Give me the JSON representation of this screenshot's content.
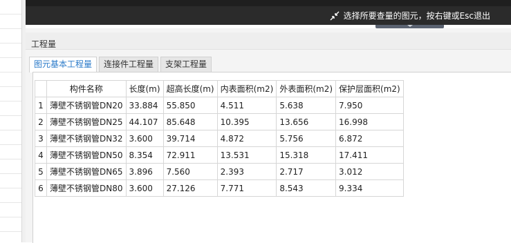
{
  "topbar": {
    "hint_text": "选择所要查量的图元，按右键或Esc退出"
  },
  "panel": {
    "title": "工程量",
    "tabs": [
      {
        "label": "图元基本工程量",
        "active": true
      },
      {
        "label": "连接件工程量",
        "active": false
      },
      {
        "label": "支架工程量",
        "active": false
      }
    ]
  },
  "table": {
    "columns": [
      "构件名称",
      "长度(m)",
      "超高长度(m)",
      "内表面积(m2)",
      "外表面积(m2)",
      "保护层面积(m2)"
    ],
    "rows": [
      {
        "index": "1",
        "name": "薄壁不锈钢管DN20",
        "length": "33.884",
        "over_length": "55.850",
        "inner_area": "4.511",
        "outer_area": "5.638",
        "protect_area": "7.950"
      },
      {
        "index": "2",
        "name": "薄壁不锈钢管DN25",
        "length": "44.107",
        "over_length": "85.648",
        "inner_area": "10.395",
        "outer_area": "13.656",
        "protect_area": "16.998"
      },
      {
        "index": "3",
        "name": "薄壁不锈钢管DN32",
        "length": "3.600",
        "over_length": "39.714",
        "inner_area": "4.872",
        "outer_area": "5.756",
        "protect_area": "6.872"
      },
      {
        "index": "4",
        "name": "薄壁不锈钢管DN50",
        "length": "8.354",
        "over_length": "72.911",
        "inner_area": "13.531",
        "outer_area": "15.318",
        "protect_area": "17.411"
      },
      {
        "index": "5",
        "name": "薄壁不锈钢管DN65",
        "length": "3.896",
        "over_length": "7.560",
        "inner_area": "2.393",
        "outer_area": "2.717",
        "protect_area": "3.012"
      },
      {
        "index": "6",
        "name": "薄壁不锈钢管DN80",
        "length": "3.600",
        "over_length": "27.126",
        "inner_area": "7.771",
        "outer_area": "8.543",
        "protect_area": "9.334"
      }
    ]
  },
  "icons": {
    "hint_icon": "shrink-arrows-icon"
  }
}
